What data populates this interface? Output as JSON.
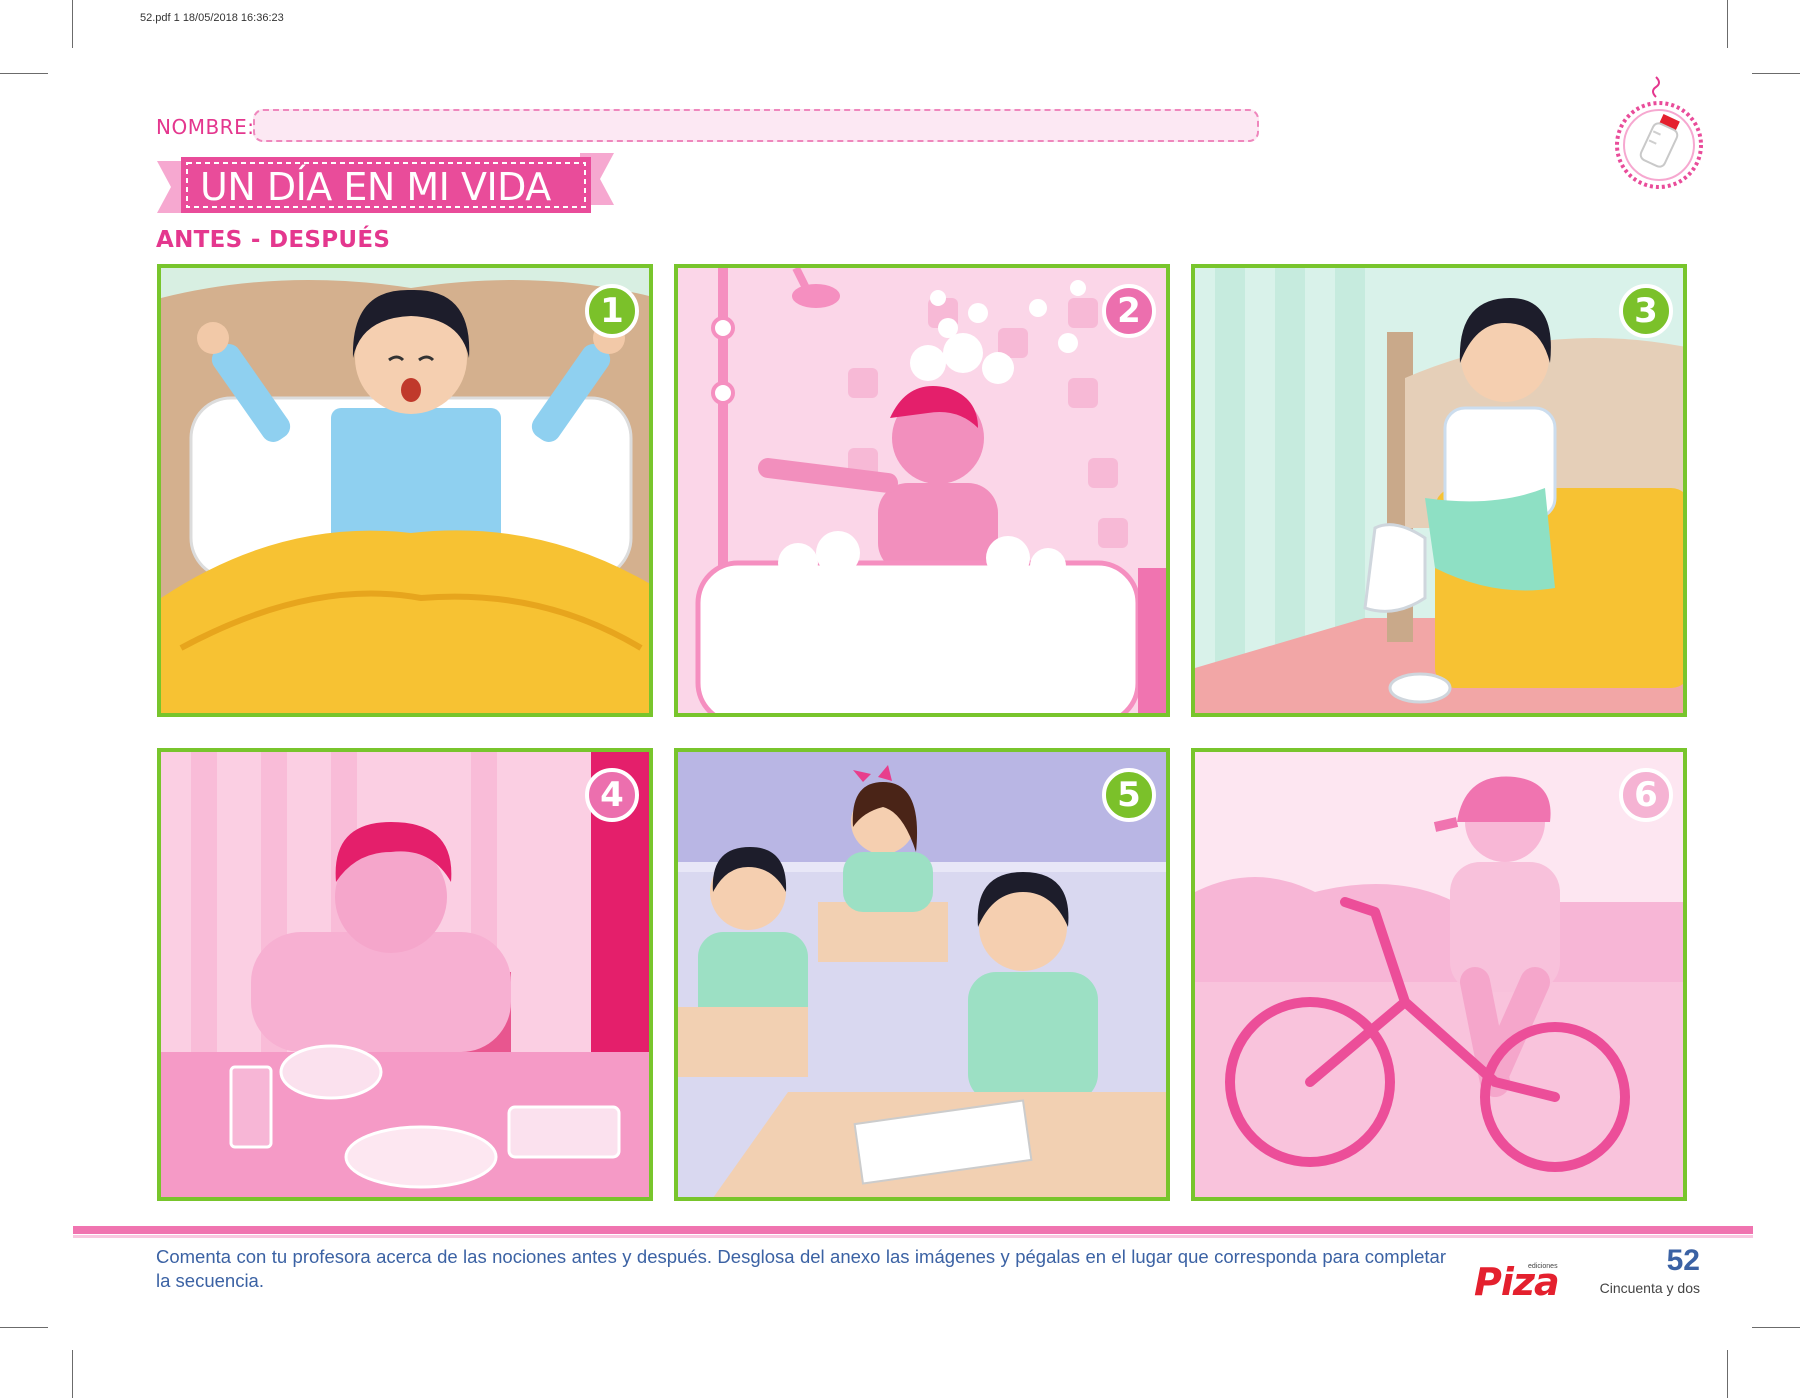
{
  "print_meta": "52.pdf   1   18/05/2018   16:36:23",
  "header": {
    "name_label": "NOMBRE:",
    "title": "UN DÍA EN MI VIDA",
    "subtitle": "ANTES - DESPUÉS"
  },
  "panels": [
    {
      "number": "1",
      "scene": "waking-up",
      "badge_color": "green"
    },
    {
      "number": "2",
      "scene": "bathing",
      "badge_color": "pink"
    },
    {
      "number": "3",
      "scene": "getting-dressed",
      "badge_color": "green"
    },
    {
      "number": "4",
      "scene": "breakfast",
      "badge_color": "pink"
    },
    {
      "number": "5",
      "scene": "school",
      "badge_color": "green"
    },
    {
      "number": "6",
      "scene": "riding-bike",
      "badge_color": "light"
    }
  ],
  "footer": {
    "instructions": "Comenta con tu profesora acerca de las nociones antes y después. Desglosa del anexo las imágenes y pégalas en el lugar que corresponda para completar la secuencia.",
    "publisher_small": "ediciones",
    "publisher": "Piza",
    "page_number": "52",
    "page_words": "Cincuenta y dos"
  },
  "colors": {
    "brand_pink": "#e4378e",
    "panel_border": "#78c52c",
    "footer_blue": "#3b62a4"
  }
}
